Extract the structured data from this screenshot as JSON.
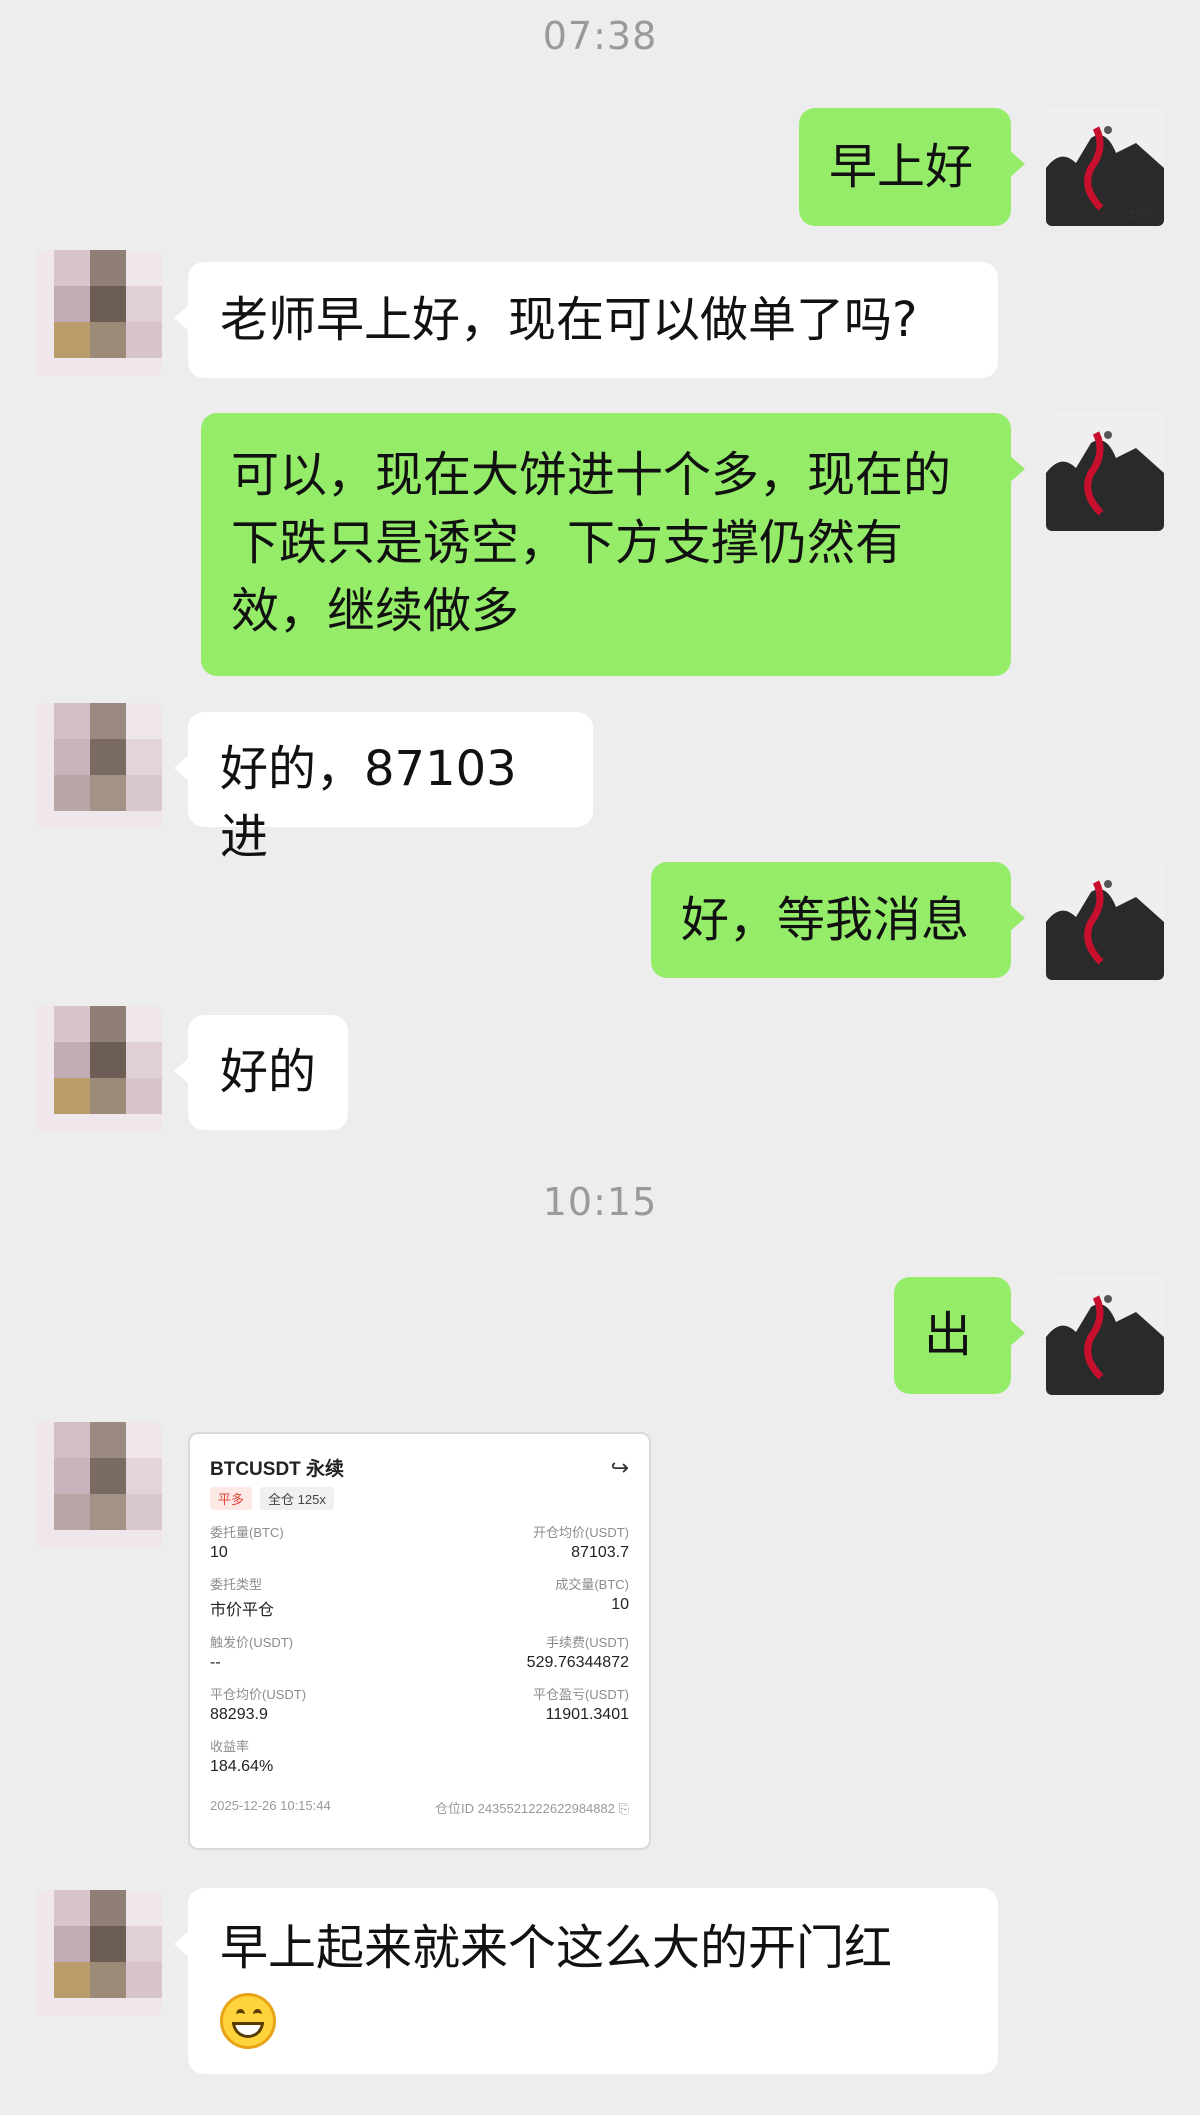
{
  "timestamps": [
    "07:38",
    "10:15"
  ],
  "messages": {
    "m1": "早上好",
    "m2": "老师早上好，现在可以做单了吗?",
    "m3": "可以，现在大饼进十个多，现在的下跌只是诱空，下方支撑仍然有效，继续做多",
    "m4": "好的，87103进",
    "m5": "好，等我消息",
    "m6": "好的",
    "m7": "出",
    "m8": "早上起来就来个这么大的开门红"
  },
  "trade_card": {
    "title": "BTCUSDT 永续",
    "tag_direction": "平多",
    "tag_margin": "全仓 125x",
    "order_qty_label": "委托量(BTC)",
    "order_qty": "10",
    "open_avg_label": "开仓均价(USDT)",
    "open_avg": "87103.7",
    "order_type_label": "委托类型",
    "order_type": "市价平仓",
    "filled_label": "成交量(BTC)",
    "filled": "10",
    "trigger_label": "触发价(USDT)",
    "trigger": "--",
    "fee_label": "手续费(USDT)",
    "fee": "529.76344872",
    "close_avg_label": "平仓均价(USDT)",
    "close_avg": "88293.9",
    "pnl_label": "平仓盈亏(USDT)",
    "pnl": "11901.3401",
    "roi_label": "收益率",
    "roi": "184.64%",
    "time": "2025-12-26 10:15:44",
    "position_id": "仓位ID 2435521222622984882"
  },
  "icons": {
    "share": "share-icon",
    "copy": "copy-icon",
    "emoji": "grinning-emoji-icon"
  },
  "colors": {
    "background": "#ededed",
    "my_bubble": "#95ec69",
    "their_bubble": "#ffffff",
    "long_tag": "#e0453a"
  }
}
